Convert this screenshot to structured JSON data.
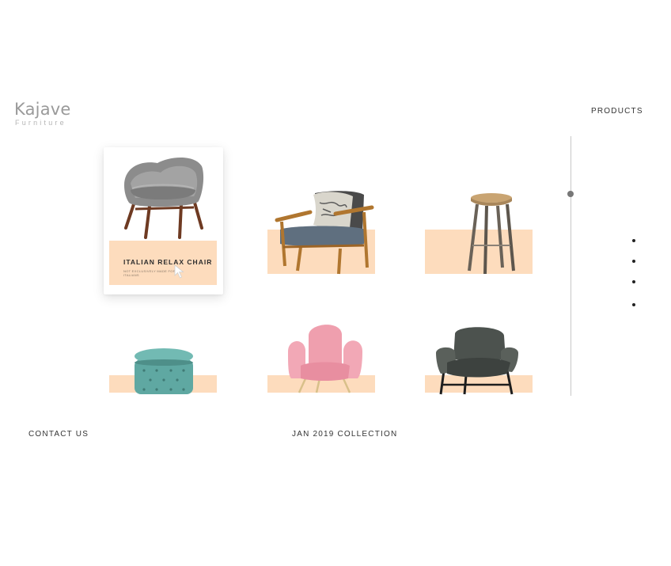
{
  "brand": {
    "name": "Kajave",
    "tagline": "Furniture"
  },
  "nav": {
    "products": "PRODUCTS",
    "contact": "CONTACT US",
    "collection": "JAN 2019 COLLECTION"
  },
  "featured": {
    "title": "ITALIAN RELAX CHAIR",
    "description": "NOT EXCLUSIVELY MADE FOR ITALIANS"
  },
  "colors": {
    "accent": "#fddcbd",
    "text": "#333333",
    "logo": "#9a9a9a"
  },
  "pagination": {
    "count": 4
  }
}
